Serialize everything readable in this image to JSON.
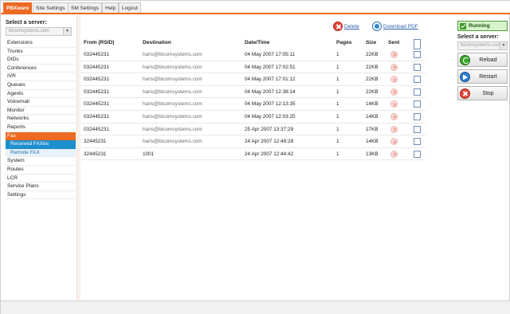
{
  "tabs": [
    {
      "label": "PBXware"
    },
    {
      "label": "Site Settings"
    },
    {
      "label": "SM Settings"
    },
    {
      "label": "Help"
    },
    {
      "label": "Logout"
    }
  ],
  "sidebar": {
    "server_title": "Select a server:",
    "server_value": "bicomsystems.com",
    "items": [
      {
        "label": "Extensions"
      },
      {
        "label": "Trunks"
      },
      {
        "label": "DIDs"
      },
      {
        "label": "Conferences"
      },
      {
        "label": "IVR"
      },
      {
        "label": "Queues"
      },
      {
        "label": "Agents"
      },
      {
        "label": "Voicemail"
      },
      {
        "label": "Monitor"
      },
      {
        "label": "Networks"
      },
      {
        "label": "Reports"
      },
      {
        "label": "Fax"
      },
      {
        "label": "Received FAXes"
      },
      {
        "label": "Remote FAX"
      },
      {
        "label": "System"
      },
      {
        "label": "Routes"
      },
      {
        "label": "LCR"
      },
      {
        "label": "Service Plans"
      },
      {
        "label": "Settings"
      }
    ]
  },
  "actions": {
    "delete_label": "Delete",
    "download_label": "Download PDF"
  },
  "table": {
    "headers": [
      "From (RSID)",
      "Destination",
      "Date/Time",
      "Pages",
      "Size",
      "Sent"
    ],
    "rows": [
      {
        "from": "032445231",
        "dest": "haris@bicomsystems.com",
        "date": "04 May 2007 17:05:11",
        "pages": "1",
        "size": "22KB"
      },
      {
        "from": "032445231",
        "dest": "haris@bicomsystems.com",
        "date": "04 May 2007 17:02:51",
        "pages": "1",
        "size": "22KB"
      },
      {
        "from": "032445231",
        "dest": "haris@bicomsystems.com",
        "date": "04 May 2007 17:01:12",
        "pages": "1",
        "size": "22KB"
      },
      {
        "from": "032445231",
        "dest": "haris@bicomsystems.com",
        "date": "04 May 2007 12:38:14",
        "pages": "1",
        "size": "22KB"
      },
      {
        "from": "032445231",
        "dest": "haris@bicomsystems.com",
        "date": "04 May 2007 12:13:35",
        "pages": "1",
        "size": "14KB"
      },
      {
        "from": "032445231",
        "dest": "haris@bicomsystems.com",
        "date": "04 May 2007 12:03:25",
        "pages": "1",
        "size": "14KB"
      },
      {
        "from": "032445231",
        "dest": "haris@bicomsystems.com",
        "date": "25 Apr 2007 13:37:29",
        "pages": "1",
        "size": "17KB"
      },
      {
        "from": "32445231",
        "dest": "haris@bicomsystems.com",
        "date": "24 Apr 2007 12:49:28",
        "pages": "1",
        "size": "14KB"
      },
      {
        "from": "32445231",
        "dest": "1001",
        "date": "24 Apr 2007 12:44:42",
        "pages": "1",
        "size": "13KB"
      }
    ]
  },
  "right_panel": {
    "status": "Running",
    "server_title": "Select a server:",
    "server_value": "bicomsystems.com",
    "reload_label": "Reload",
    "restart_label": "Restart",
    "stop_label": "Stop"
  }
}
